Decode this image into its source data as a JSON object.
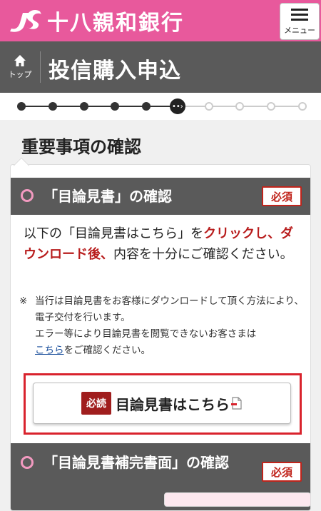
{
  "header": {
    "bank_name": "十八親和銀行",
    "brand_color": "#e8599c",
    "menu_icon": "hamburger-icon",
    "menu_label": "メニュー"
  },
  "titlebar": {
    "home_icon": "home-icon",
    "top_label": "トップ",
    "page_title": "投信購入申込"
  },
  "progress": {
    "total_steps": 10,
    "current_step": 6
  },
  "main": {
    "section_heading": "重要事項の確認",
    "items": [
      {
        "title": "「目論見書」の確認",
        "required_badge": "必須",
        "text_before": "以下の「目論見書はこちら」を",
        "text_emphasis": "クリックし、ダウンロード後、",
        "text_after": "内容を十分にご確認ください。",
        "note_mark": "※",
        "note_line1": "当行は目論見書をお客様にダウンロードして頂く方法により、電子交付を行います。",
        "note_line2": "エラー等により目論見書を閲覧できないお客さまは",
        "note_link": "こちら",
        "note_line3": "をご確認ください。",
        "must_read_badge": "必読",
        "download_label": "目論見書はこちら",
        "download_icon": "document-icon"
      },
      {
        "title": "「目論見書補完書面」の確認",
        "required_badge": "必須"
      }
    ]
  },
  "colors": {
    "titlebar": "#5a5a5a",
    "required_red": "#c0241b",
    "emphasis_red": "#b81c1c",
    "ring_pink": "#f29ac0"
  }
}
